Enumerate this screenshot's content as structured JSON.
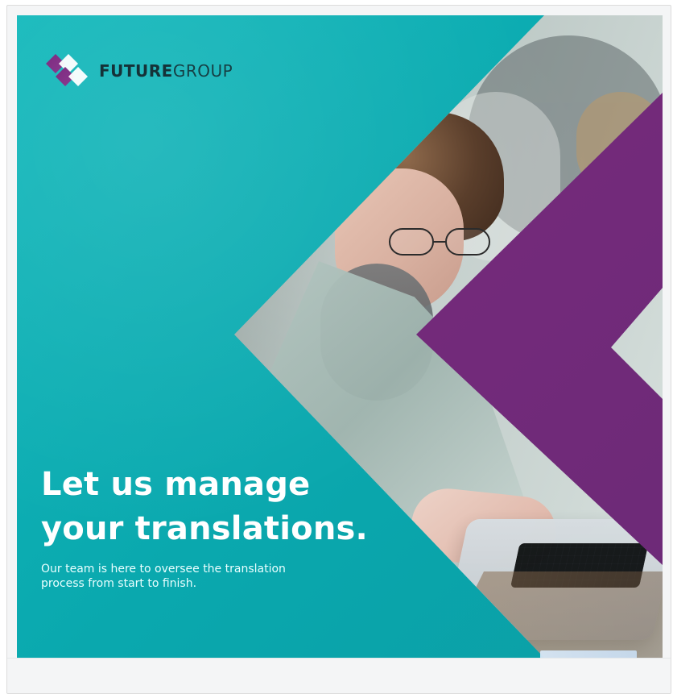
{
  "brand": {
    "name_strong": "FUTURE",
    "name_light": "GROUP"
  },
  "copy": {
    "headline_line_1": "Let us manage",
    "headline_line_2": "your translations.",
    "subtext": "Our team is here to oversee the translation process from start to finish."
  },
  "colors": {
    "teal": "#0fb2b6",
    "purple": "#7c2b7f",
    "white": "#ffffff",
    "logo_text": "#153238"
  }
}
